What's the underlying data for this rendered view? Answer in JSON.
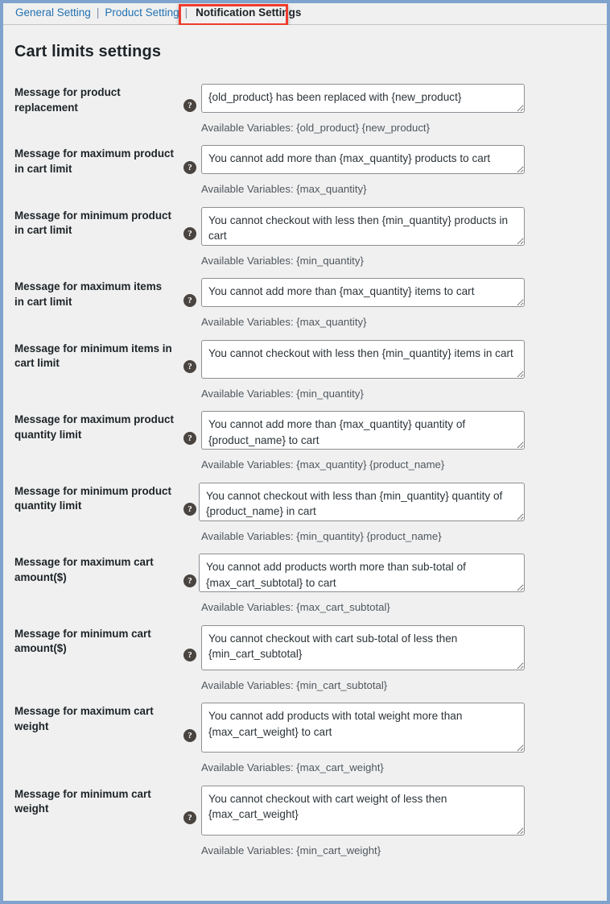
{
  "tabs": {
    "items": [
      {
        "label": "General Setting",
        "active": false
      },
      {
        "label": "Product Setting",
        "active": false
      },
      {
        "label": "Notification Settings",
        "active": true
      }
    ],
    "separator": "|",
    "highlight_color": "#ef3b2d"
  },
  "page": {
    "title": "Cart limits settings",
    "accent_link_color": "#2271b1",
    "background_color": "#f0f0f0",
    "frame_border_color": "#7fa3cc"
  },
  "help_icon": {
    "glyph": "?",
    "name": "help-icon"
  },
  "available_prefix": "Available Variables:",
  "fields": [
    {
      "label": "Message for product replacement",
      "value": "{old_product} has been replaced with {new_product}",
      "available": "Available Variables: {old_product} {new_product}",
      "rows": 1
    },
    {
      "label": "Message for maximum product in cart limit",
      "value": "You cannot add more than {max_quantity} products to cart",
      "available": "Available Variables: {max_quantity}",
      "rows": 1
    },
    {
      "label": "Message for minimum product in cart limit",
      "value": "You cannot checkout with less then {min_quantity} products in cart",
      "available": "Available Variables: {min_quantity}",
      "rows": 2
    },
    {
      "label": "Message for maximum items in cart limit",
      "value": "You cannot add more than {max_quantity} items to cart",
      "available": "Available Variables: {max_quantity}",
      "rows": 1
    },
    {
      "label": "Message for minimum items in cart limit",
      "value": "You cannot checkout with less then {min_quantity} items in cart",
      "available": "Available Variables: {min_quantity}",
      "rows": 2
    },
    {
      "label": "Message for maximum product quantity limit",
      "value": "You cannot add more than {max_quantity} quantity of {product_name} to cart",
      "available": "Available Variables: {max_quantity} {product_name}",
      "rows": 2
    },
    {
      "label": "Message for minimum product quantity limit",
      "value": "You cannot checkout with less than {min_quantity} quantity of {product_name} in cart",
      "available": "Available Variables: {min_quantity} {product_name}",
      "rows": 2
    },
    {
      "label": "Message for maximum cart amount($)",
      "value": "You cannot add products worth more than sub-total of {max_cart_subtotal} to cart",
      "available": "Available Variables: {max_cart_subtotal}",
      "rows": 2
    },
    {
      "label": "Message for minimum cart amount($)",
      "value": "You cannot checkout with cart sub-total of less then {min_cart_subtotal}",
      "available": "Available Variables: {min_cart_subtotal}",
      "rows": 2,
      "spellcheck_word": "{min_cart_subtotal}"
    },
    {
      "label": "Message for maximum cart weight",
      "value": "You cannot add products with total weight more than {max_cart_weight} to cart",
      "available": "Available Variables: {max_cart_weight}",
      "rows": 3
    },
    {
      "label": "Message for minimum cart weight",
      "value": "You cannot checkout with cart weight of less then {max_cart_weight}",
      "available": "Available Variables: {min_cart_weight}",
      "rows": 3
    }
  ]
}
